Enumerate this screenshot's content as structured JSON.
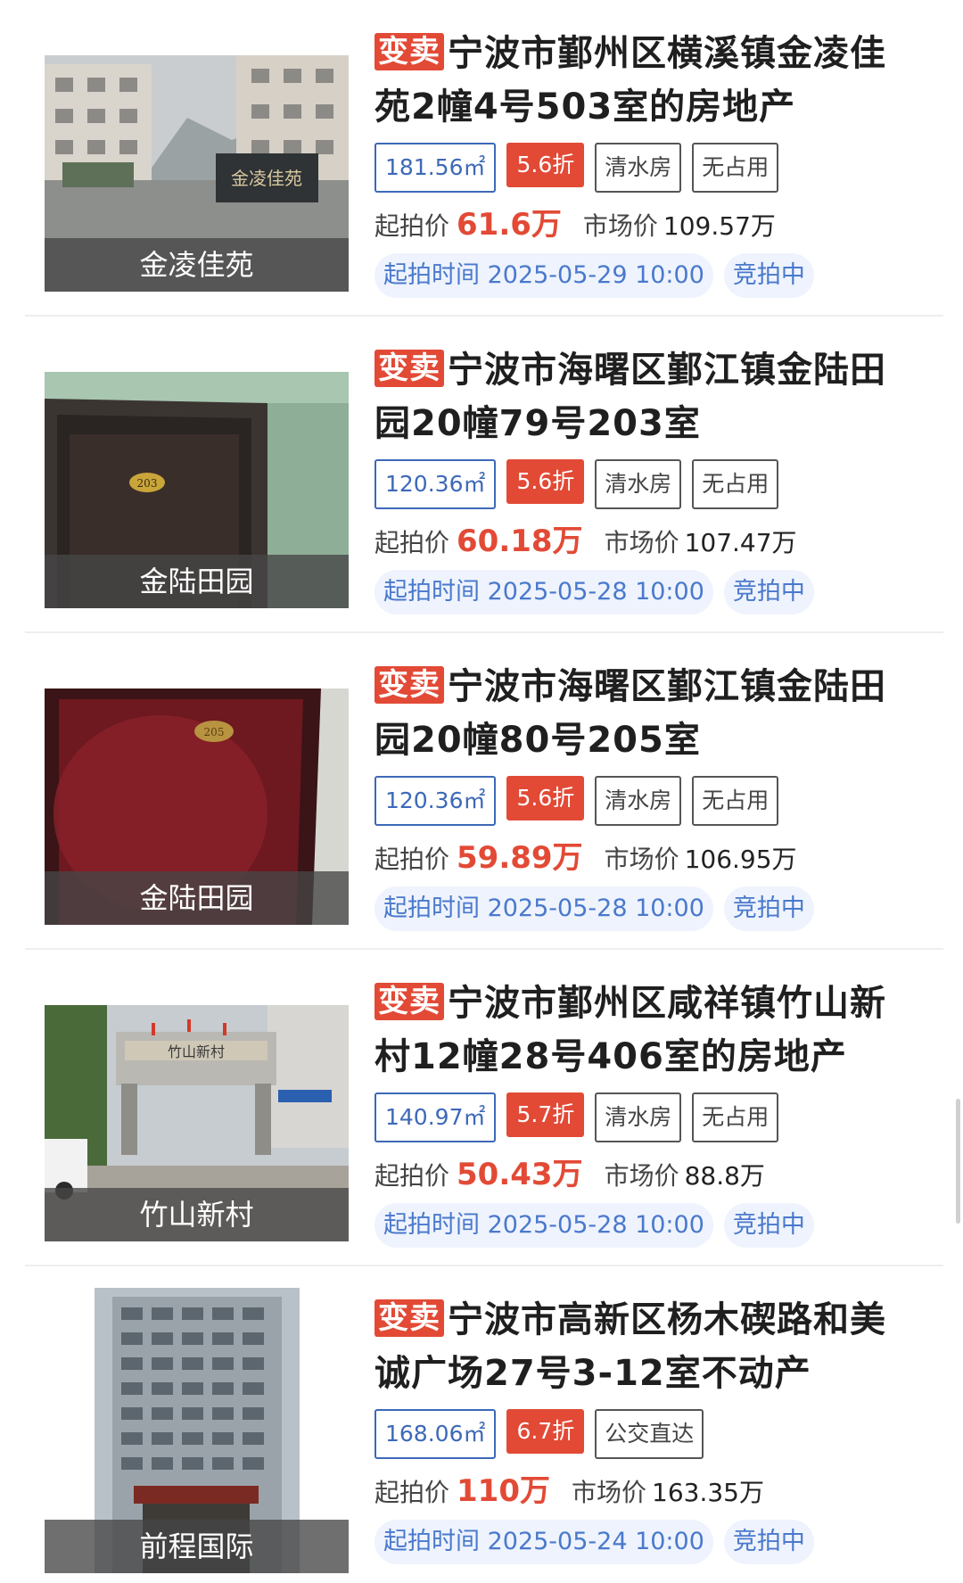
{
  "colors": {
    "accent_red": "#e24a36",
    "accent_blue": "#3d69b8",
    "pill_bg": "#eef3fd",
    "pill_text": "#4a79cc"
  },
  "labels": {
    "start_price": "起拍价",
    "market_price": "市场价"
  },
  "listings": [
    {
      "tag": "变卖",
      "title": "宁波市鄞州区横溪镇金凌佳苑2幢4号503室的房地产",
      "area": "181.56㎡",
      "discount": "5.6折",
      "features": [
        "清水房",
        "无占用"
      ],
      "start_price": "61.6万",
      "market_price": "109.57万",
      "auction_time": "起拍时间 2025-05-29 10:00",
      "status": "竞拍中",
      "image_caption": "金凌佳苑",
      "image_sign_text": "金凌佳苑"
    },
    {
      "tag": "变卖",
      "title": "宁波市海曙区鄞江镇金陆田园20幢79号203室",
      "area": "120.36㎡",
      "discount": "5.6折",
      "features": [
        "清水房",
        "无占用"
      ],
      "start_price": "60.18万",
      "market_price": "107.47万",
      "auction_time": "起拍时间 2025-05-28 10:00",
      "status": "竞拍中",
      "image_caption": "金陆田园",
      "image_sign_text": "203"
    },
    {
      "tag": "变卖",
      "title": "宁波市海曙区鄞江镇金陆田园20幢80号205室",
      "area": "120.36㎡",
      "discount": "5.6折",
      "features": [
        "清水房",
        "无占用"
      ],
      "start_price": "59.89万",
      "market_price": "106.95万",
      "auction_time": "起拍时间 2025-05-28 10:00",
      "status": "竞拍中",
      "image_caption": "金陆田园",
      "image_sign_text": "205"
    },
    {
      "tag": "变卖",
      "title": "宁波市鄞州区咸祥镇竹山新村12幢28号406室的房地产",
      "area": "140.97㎡",
      "discount": "5.7折",
      "features": [
        "清水房",
        "无占用"
      ],
      "start_price": "50.43万",
      "market_price": "88.8万",
      "auction_time": "起拍时间 2025-05-28 10:00",
      "status": "竞拍中",
      "image_caption": "竹山新村",
      "image_sign_text": "竹山新村"
    },
    {
      "tag": "变卖",
      "title": "宁波市高新区杨木碶路和美诚广场27号3-12室不动产",
      "area": "168.06㎡",
      "discount": "6.7折",
      "features": [
        "公交直达"
      ],
      "start_price": "110万",
      "market_price": "163.35万",
      "auction_time": "起拍时间 2025-05-24 10:00",
      "status": "竞拍中",
      "image_caption": "前程国际",
      "image_sign_text": ""
    }
  ]
}
